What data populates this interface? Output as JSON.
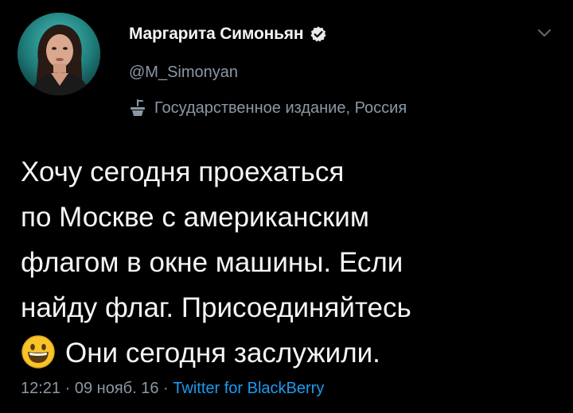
{
  "author": {
    "display_name": "Маргарита Симоньян",
    "handle": "@M_Simonyan",
    "verified": true,
    "verified_icon": "verified-badge-icon",
    "avatar_icon": "profile-photo"
  },
  "menu": {
    "icon": "chevron-down-icon"
  },
  "account_label": {
    "icon": "state-media-icon",
    "text": "Государственное издание, Россия"
  },
  "tweet": {
    "lines": [
      "Хочу сегодня проехаться",
      "по Москве с американским",
      "флагом в окне машины. Если",
      "найду флаг. Присоединяйтесь",
      "Они сегодня заслужили."
    ],
    "emoji": "grinning-face-emoji"
  },
  "meta": {
    "time": "12:21",
    "separator": "·",
    "date": "09 нояб. 16",
    "source": "Twitter for BlackBerry"
  },
  "colors": {
    "background": "#000000",
    "text_primary": "#f4f5f6",
    "text_secondary": "#8b98a5",
    "link": "#1d9bf0"
  }
}
